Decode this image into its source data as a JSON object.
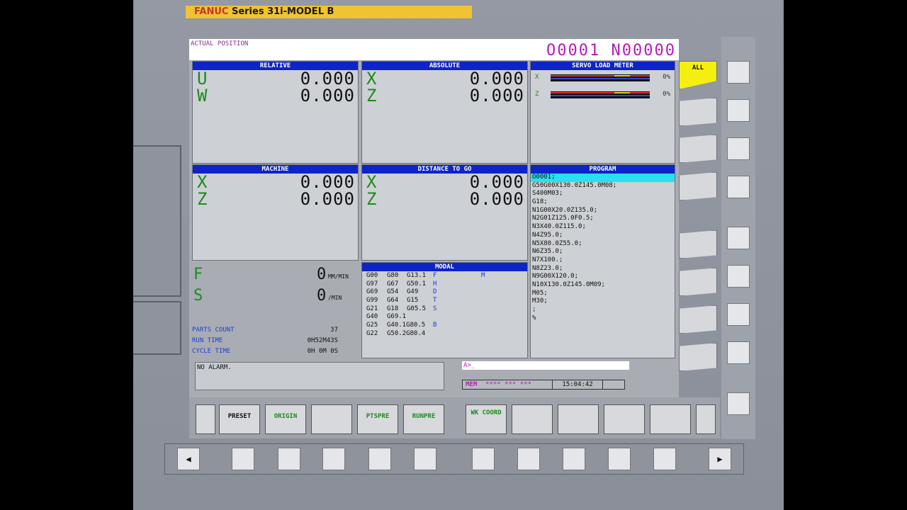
{
  "brand": {
    "maker": "FANUC",
    "model": " Series 31i-MODEL B"
  },
  "header": {
    "title": "ACTUAL POSITION",
    "program_number": "O0001 N00000"
  },
  "relative": {
    "title": "RELATIVE",
    "axes": [
      {
        "name": "U",
        "value": "0.000"
      },
      {
        "name": "W",
        "value": "0.000"
      }
    ]
  },
  "absolute": {
    "title": "ABSOLUTE",
    "axes": [
      {
        "name": "X",
        "value": "0.000"
      },
      {
        "name": "Z",
        "value": "0.000"
      }
    ]
  },
  "machine": {
    "title": "MACHINE",
    "axes": [
      {
        "name": "X",
        "value": "0.000"
      },
      {
        "name": "Z",
        "value": "0.000"
      }
    ]
  },
  "distance": {
    "title": "DISTANCE TO GO",
    "axes": [
      {
        "name": "X",
        "value": "0.000"
      },
      {
        "name": "Z",
        "value": "0.000"
      }
    ]
  },
  "servo": {
    "title": "SERVO LOAD METER",
    "axes": [
      {
        "name": "X",
        "percent": "0%"
      },
      {
        "name": "Z",
        "percent": "0%"
      }
    ]
  },
  "program": {
    "title": "PROGRAM",
    "lines": [
      "O0001;",
      "G50G00X130.0Z145.0M08;",
      "S400M03;",
      "G18;",
      "N1G00X20.0Z135.0;",
      "N2G01Z125.0F0.5;",
      "N3X40.0Z115.0;",
      "N4Z95.0;",
      "N5X80.0Z55.0;",
      "N6Z35.0;",
      "N7X100.;",
      "N8Z23.0;",
      "N9G00X120.0;",
      "N10X130.0Z145.0M09;",
      "M05;",
      "M30;",
      ";",
      "%"
    ]
  },
  "modal": {
    "title": "MODAL",
    "rows": [
      {
        "c1": "G00",
        "c2": "G80",
        "c3": "G13.1",
        "k": "F",
        "m": "M"
      },
      {
        "c1": "G97",
        "c2": "G67",
        "c3": "G50.1",
        "k": "H",
        "m": ""
      },
      {
        "c1": "G69",
        "c2": "G54",
        "c3": "G49",
        "k": "D",
        "m": ""
      },
      {
        "c1": "G99",
        "c2": "G64",
        "c3": "G15",
        "k": "T",
        "m": ""
      },
      {
        "c1": "G21",
        "c2": "G18",
        "c3": "G05.5",
        "k": "S",
        "m": ""
      },
      {
        "c1": "G40",
        "c2": "G69.1",
        "c3": "",
        "k": "",
        "m": ""
      },
      {
        "c1": "G25",
        "c2": "G40.1G80.5",
        "c3": "",
        "k": "B",
        "m": ""
      },
      {
        "c1": "G22",
        "c2": "G50.2G80.4",
        "c3": "",
        "k": "",
        "m": ""
      }
    ]
  },
  "feed": {
    "label": "F",
    "value": "0",
    "unit": "MM/MIN"
  },
  "speed": {
    "label": "S",
    "value": "0",
    "unit": "/MIN"
  },
  "info": [
    {
      "label": "PARTS COUNT",
      "value": "37"
    },
    {
      "label": "RUN TIME",
      "value": "0H52M43S"
    },
    {
      "label": "CYCLE TIME",
      "value": "0H 0M 0S"
    }
  ],
  "alarm": "NO ALARM.",
  "input_prompt": "A>_",
  "status": {
    "mode": "MEM",
    "state": "**** *** ***",
    "time": "15:04:42"
  },
  "softkeys": [
    "PRESET",
    "ORIGIN",
    "",
    "PTSPRE",
    "RUNPRE",
    "WK COORD",
    "",
    "",
    "",
    ""
  ],
  "vertical_keys": {
    "all": "ALL"
  },
  "nav": {
    "left": "◀",
    "right": "▶"
  }
}
